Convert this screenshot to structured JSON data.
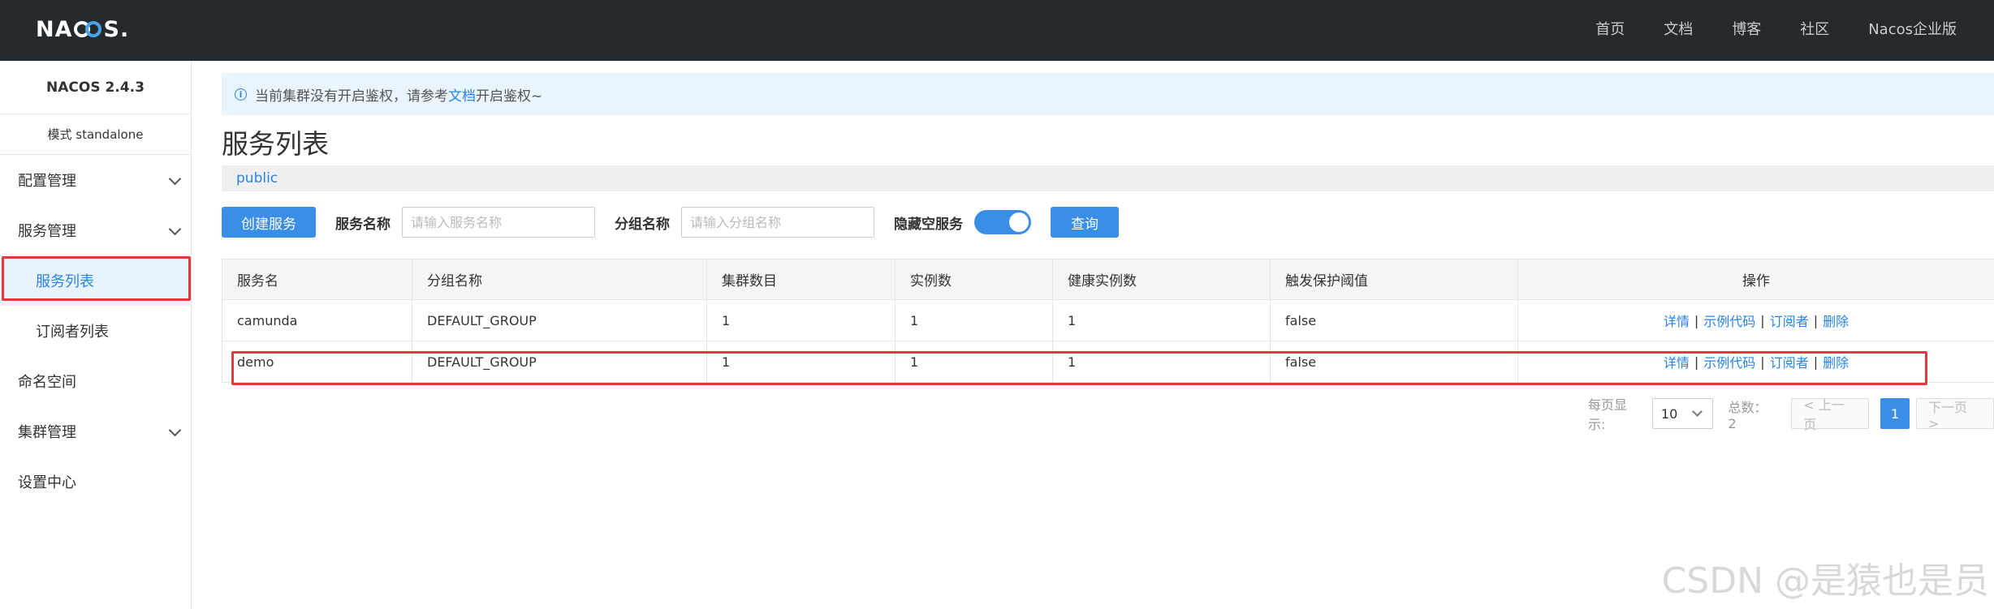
{
  "header": {
    "logo_text": "NACOS.",
    "nav": [
      "首页",
      "文档",
      "博客",
      "社区",
      "Nacos企业版"
    ]
  },
  "sidebar": {
    "version": "NACOS 2.4.3",
    "mode": "模式 standalone",
    "items": [
      {
        "label": "配置管理",
        "expandable": true
      },
      {
        "label": "服务管理",
        "expandable": true
      },
      {
        "label": "服务列表",
        "sub": true,
        "active": true
      },
      {
        "label": "订阅者列表",
        "sub": true
      },
      {
        "label": "命名空间"
      },
      {
        "label": "集群管理",
        "expandable": true
      },
      {
        "label": "设置中心"
      }
    ]
  },
  "notice": {
    "prefix": "当前集群没有开启鉴权，请参考",
    "link": "文档",
    "suffix": "开启鉴权~"
  },
  "page_title": "服务列表",
  "namespace": "public",
  "toolbar": {
    "create_label": "创建服务",
    "service_name_label": "服务名称",
    "service_name_placeholder": "请输入服务名称",
    "group_name_label": "分组名称",
    "group_name_placeholder": "请输入分组名称",
    "hide_empty_label": "隐藏空服务",
    "hide_empty_on": true,
    "query_label": "查询"
  },
  "table": {
    "headers": [
      "服务名",
      "分组名称",
      "集群数目",
      "实例数",
      "健康实例数",
      "触发保护阈值",
      "操作"
    ],
    "rows": [
      [
        "camunda",
        "DEFAULT_GROUP",
        "1",
        "1",
        "1",
        "false"
      ],
      [
        "demo",
        "DEFAULT_GROUP",
        "1",
        "1",
        "1",
        "false"
      ]
    ],
    "actions": [
      "详情",
      "示例代码",
      "订阅者",
      "删除"
    ]
  },
  "pagination": {
    "per_page_label": "每页显示:",
    "per_page_value": "10",
    "total_label": "总数：2",
    "prev_label": "< 上一页",
    "current_page": "1",
    "next_label": "下一页 >"
  },
  "watermark": "CSDN @是猿也是员",
  "colors": {
    "topbar": "#252a2f",
    "primary": "#3a8ee6",
    "link": "#2784e6",
    "highlight": "#e4393c"
  }
}
